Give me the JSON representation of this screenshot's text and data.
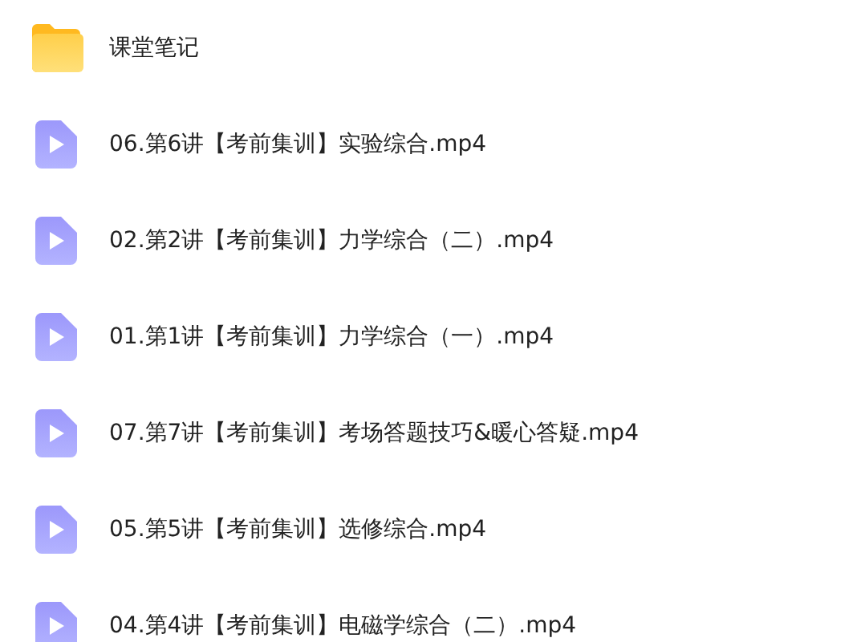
{
  "items": [
    {
      "kind": "folder",
      "name": "课堂笔记"
    },
    {
      "kind": "video",
      "name": "06.第6讲【考前集训】实验综合.mp4"
    },
    {
      "kind": "video",
      "name": "02.第2讲【考前集训】力学综合（二）.mp4"
    },
    {
      "kind": "video",
      "name": "01.第1讲【考前集训】力学综合（一）.mp4"
    },
    {
      "kind": "video",
      "name": "07.第7讲【考前集训】考场答题技巧&暖心答疑.mp4"
    },
    {
      "kind": "video",
      "name": "05.第5讲【考前集训】选修综合.mp4"
    },
    {
      "kind": "video",
      "name": "04.第4讲【考前集训】电磁学综合（二）.mp4"
    }
  ]
}
